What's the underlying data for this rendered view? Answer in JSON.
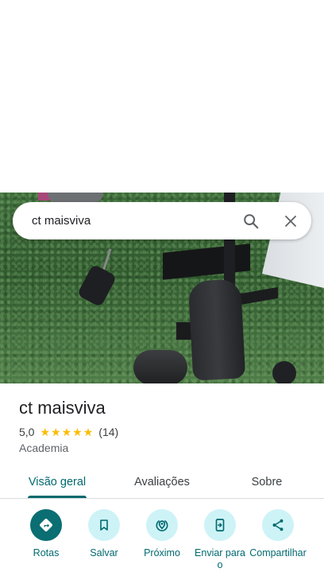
{
  "search": {
    "query": "ct maisviva"
  },
  "place": {
    "name": "ct maisviva",
    "rating": "5,0",
    "review_count": "(14)",
    "stars": 5,
    "category": "Academia"
  },
  "tabs": [
    {
      "label": "Visão geral",
      "active": true
    },
    {
      "label": "Avaliações",
      "active": false
    },
    {
      "label": "Sobre",
      "active": false
    }
  ],
  "actions": [
    {
      "label": "Rotas",
      "icon": "directions-icon"
    },
    {
      "label": "Salvar",
      "icon": "bookmark-icon"
    },
    {
      "label": "Próximo",
      "icon": "nearby-icon"
    },
    {
      "label": "Enviar para o",
      "icon": "send-to-phone-icon"
    },
    {
      "label": "Compartilhar",
      "icon": "share-icon"
    }
  ],
  "colors": {
    "accent": "#00696f",
    "primary_button": "#0a6e73",
    "action_bg": "#cdf3f7",
    "star": "#fbbc04"
  }
}
